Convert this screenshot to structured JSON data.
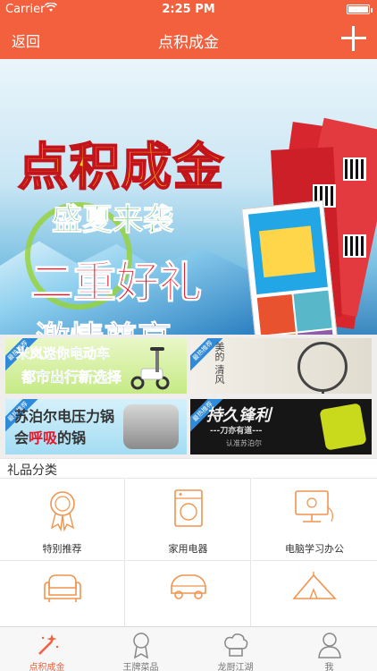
{
  "status_bar": {
    "carrier": "Carrier",
    "time": "2:25 PM",
    "battery_level": 1.0
  },
  "nav": {
    "back_label": "返回",
    "title": "点积成金",
    "add_icon": "plus-icon"
  },
  "hero_banner": {
    "headline": "点积成金",
    "line2": "盛夏来袭",
    "line3": "二重好礼",
    "line4": "激情尊享"
  },
  "promos": [
    {
      "tag": "最热推荐",
      "line1": "米岚迷你电动车",
      "line2": "都市出行新选择"
    },
    {
      "tag": "最热推荐",
      "line1": "美的 清风"
    },
    {
      "tag": "最热推荐",
      "line1": "苏泊尔电压力锅",
      "line2_prefix": "会",
      "line2_highlight": "呼吸",
      "line2_suffix": "的锅"
    },
    {
      "tag": "最热推荐",
      "line1": "持久锋利",
      "line2": "---刀亦有道---",
      "line3": "认准苏泊尔"
    }
  ],
  "categories": {
    "heading": "礼品分类",
    "items": [
      {
        "label": "特别推荐",
        "icon": "award-ribbon-icon"
      },
      {
        "label": "家用电器",
        "icon": "washing-machine-icon"
      },
      {
        "label": "电脑学习办公",
        "icon": "monitor-icon"
      },
      {
        "label": "",
        "icon": "sofa-icon"
      },
      {
        "label": "",
        "icon": "car-icon"
      },
      {
        "label": "",
        "icon": "tent-icon"
      }
    ]
  },
  "tabbar": {
    "tabs": [
      {
        "label": "点积成金",
        "icon": "magic-wand-icon",
        "active": true
      },
      {
        "label": "王牌菜品",
        "icon": "medal-icon",
        "active": false
      },
      {
        "label": "龙厨江湖",
        "icon": "chef-hat-icon",
        "active": false
      },
      {
        "label": "我",
        "icon": "person-icon",
        "active": false
      }
    ]
  },
  "colors": {
    "accent": "#f2603d",
    "icon_orange": "#f0944f",
    "tab_inactive": "#777777"
  }
}
